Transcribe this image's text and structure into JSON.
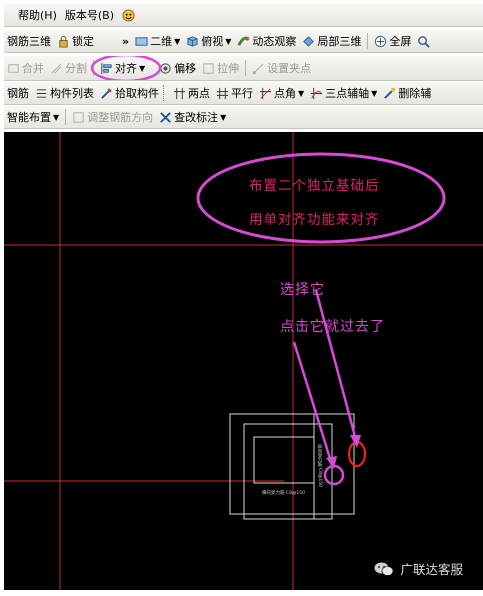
{
  "menu": {
    "items": [
      "帮助(H)",
      "版本号(B)"
    ]
  },
  "toolbar1": {
    "rebar_3d": "钢筋三维",
    "lock": "锁定",
    "overflow": "»",
    "view_2d": "二维",
    "top_view": "俯视",
    "dynamic_orbit": "动态观察",
    "local_3d": "局部三维",
    "fullscreen": "全屏"
  },
  "toolbar2": {
    "merge": "合并",
    "split": "分割",
    "align": "对齐",
    "offset": "偏移",
    "stretch": "拉伸",
    "set_grip": "设置夹点"
  },
  "toolbar3": {
    "rebar": "钢筋",
    "component_list": "构件列表",
    "pick_component": "拾取构件",
    "two_points": "两点",
    "parallel": "平行",
    "point_angle": "点角",
    "three_point_axis": "三点辅轴",
    "delete_axis": "删除辅"
  },
  "toolbar4": {
    "smart_layout": "智能布置",
    "adjust_rebar_dir": "调整钢筋方向",
    "check_annotation": "查改标注"
  },
  "callout": {
    "line1": "布置二个独立基础后",
    "line2": "用单对齐功能来对齐"
  },
  "annotation": {
    "select_it": "选择它",
    "click_it": "点击它就过去了"
  },
  "cad_labels": {
    "horizontal": "横向受力筋 C8@150",
    "vertical": "纵向受力筋 C8@150"
  },
  "watermark": {
    "text": "广联达客服"
  },
  "colors": {
    "accent_magenta": "#d64ad6",
    "callout_text": "#e0206a",
    "grid_red": "#c23030",
    "highlight_red": "#ff2020"
  }
}
